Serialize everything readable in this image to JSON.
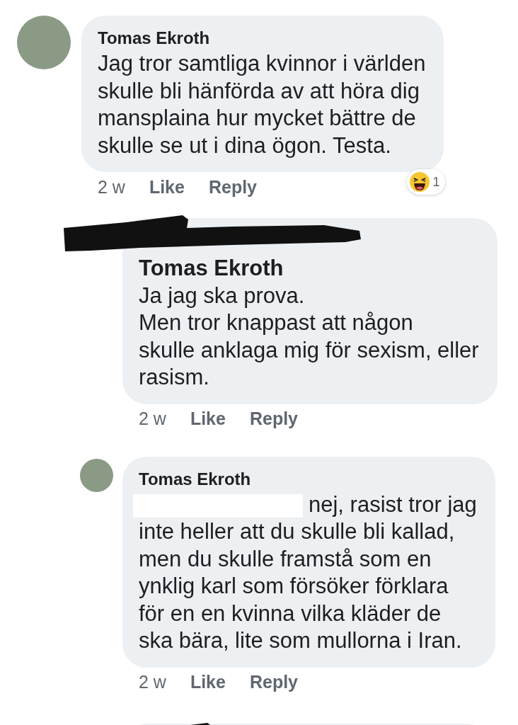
{
  "comments": [
    {
      "kind": "top",
      "author": "Tomas Ekroth",
      "author_redacted": false,
      "text_redacted_start": false,
      "text": "Jag tror samtliga kvinnor i världen\nskulle bli hänförda av att höra dig\nmansplaina hur mycket bättre de\nskulle se ut i dina ögon. Testa.",
      "time": "2 w",
      "actions": [
        "Like",
        "Reply"
      ],
      "reaction": {
        "count": "1"
      }
    },
    {
      "kind": "reply",
      "author_redacted": true,
      "text_redacted_start": false,
      "text": "**Tomas Ekroth**\nJa jag ska prova.\nMen tror knappast att någon\nskulle anklaga mig för sexism, eller\nrasism.",
      "time": "2 w",
      "actions": [
        "Like",
        "Reply"
      ]
    },
    {
      "kind": "reply",
      "author": "Tomas Ekroth",
      "author_redacted": false,
      "text_redacted_start": true,
      "text": "nej, rasist tror jag\ninte heller att du skulle bli kallad,\nmen du skulle framstå som en\nynklig karl som försöker förklara\nför en en kvinna vilka kläder de\nska bära, lite som mullorna i Iran.",
      "time": "2 w",
      "actions": [
        "Like",
        "Reply"
      ]
    },
    {
      "kind": "partial",
      "author_redacted": true,
      "text_redacted_start": false
    }
  ]
}
